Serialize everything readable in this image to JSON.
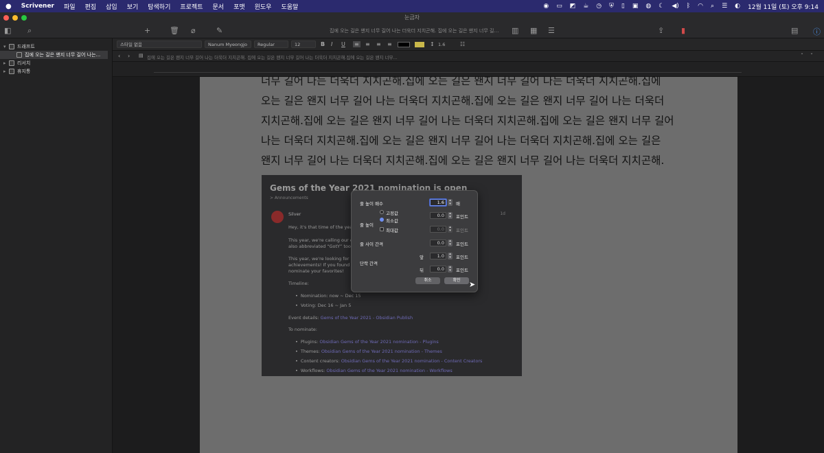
{
  "menubar": {
    "apple": "",
    "app": "Scrivener",
    "items": [
      "파일",
      "편집",
      "삽입",
      "보기",
      "탐색하기",
      "프로젝트",
      "문서",
      "포맷",
      "윈도우",
      "도움말"
    ],
    "clock": "12월 11일 (토) 오후 9:14"
  },
  "window": {
    "title": "눈금자"
  },
  "toolbar": {
    "doc_title": "집에 오는 길은 왠지 너무 길어 나는 더욱더 지치곤해. 집에 오는 길은 왠지 너무 길어 나는 더욱..."
  },
  "sidebar": {
    "items": [
      {
        "label": "드래프트",
        "expanded": true
      },
      {
        "label": "집에 오는 길은 왠지 너무 길어 나는...",
        "child": true
      },
      {
        "label": "리서치"
      },
      {
        "label": "휴지통"
      }
    ]
  },
  "formatbar": {
    "style": "스타일 없음",
    "font": "Nanum Myeongjo",
    "weight": "Regular",
    "size": "12",
    "line_spacing": "1.6"
  },
  "pathbar": {
    "text": "집에 오는 길은 왠지 너무 길어 나는 더욱더 지치곤해. 집에 오는 길은 왠지 너무 길어 나는 더욱더 지치곤해.집에 오는 길은 왠지 너무..."
  },
  "editor": {
    "lines": [
      "너무 길어 나는 더욱더 지치곤해.집에 오는 길은 왠지 너무 길어 나는 더욱더 지치곤해.집에",
      "오는 길은 왠지 너무 길어 나는 더욱더 지치곤해.집에 오는 길은 왠지 너무 길어 나는 더욱더",
      "지치곤해.집에 오는 길은 왠지 너무 길어 나는 더욱더 지치곤해.집에 오는 길은 왠지 너무 길어",
      "나는 더욱더 지치곤해.집에 오는 길은 왠지 너무 길어 나는 더욱더 지치곤해.집에 오는 길은",
      "왠지 너무 길어 나는 더욱더 지치곤해.집에 오는 길은 왠지 너무 길어 나는 더욱더 지치곤해."
    ]
  },
  "embed": {
    "title": "Gems of the Year 2021 nomination is open",
    "subtitle": "> Announcements",
    "author": "Silver",
    "day": "1d",
    "lines": [
      "Hey, it's that time of the year again!",
      "This year, we're calling our event “Gems of the Year” — incidentally",
      "also abbreviated “GotY” too.",
      "This year, we're looking for ... and",
      "achievements! If you found ... come and",
      "nominate your favorites!"
    ],
    "timeline_label": "Timeline:",
    "timeline": [
      "Nomination: now ~ Dec 15",
      "Voting: Dec 16 ~ Jan 5"
    ],
    "event_label": "Event details:",
    "event_link": "Gems of the Year 2021 - Obsidian Publish",
    "nominate_label": "To nominate:",
    "nominate": [
      {
        "k": "Plugins:",
        "v": "Obsidian Gems of the Year 2021 nomination - Plugins"
      },
      {
        "k": "Themes:",
        "v": "Obsidian Gems of the Year 2021 nomination - Themes"
      },
      {
        "k": "Content creators:",
        "v": "Obsidian Gems of the Year 2021 nomination - Content Creators"
      },
      {
        "k": "Workflows:",
        "v": "Obsidian Gems of the Year 2021 nomination - Workflows"
      }
    ]
  },
  "dialog": {
    "multiple_label": "줄 높이 배수",
    "multiple_value": "1.6",
    "multiple_unit": "배",
    "height_label": "줄 높이",
    "opt_fixed": "고정값",
    "opt_min": "최소값",
    "opt_max": "최대값",
    "min_value": "0.0",
    "max_value": "0.0",
    "point": "포인트",
    "between_label": "줄 사이 간격",
    "between_value": "0.0",
    "para_label": "단락 간격",
    "before": "앞",
    "before_value": "1.0",
    "after": "뒤",
    "after_value": "0.0",
    "cancel": "취소",
    "ok": "확인"
  }
}
